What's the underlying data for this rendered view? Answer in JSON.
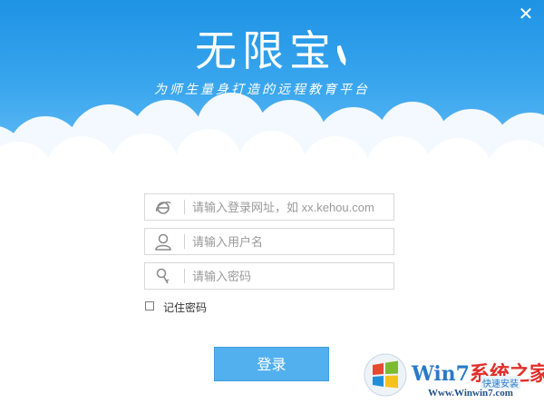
{
  "header": {
    "logo_text": "无限宝",
    "slogan": "为师生量身打造的远程教育平台",
    "close_glyph": "✕"
  },
  "form": {
    "url_placeholder": "请输入登录网址，如 xx.kehou.com",
    "user_placeholder": "请输入用户名",
    "password_placeholder": "请输入密码",
    "remember_label": "记住密码",
    "remember_checked": false,
    "login_label": "登录"
  },
  "icons": {
    "url": "ie-logo-icon",
    "user": "user-icon",
    "password": "key-icon"
  },
  "watermark": {
    "title_part1": "Win7",
    "title_part2": "系统之家",
    "small_text": "快速安装",
    "url": "Www.Winwin7.com"
  },
  "colors": {
    "header_blue": "#2a9ae8",
    "button_blue": "#53b0ee",
    "field_border": "#d9d9d9"
  }
}
